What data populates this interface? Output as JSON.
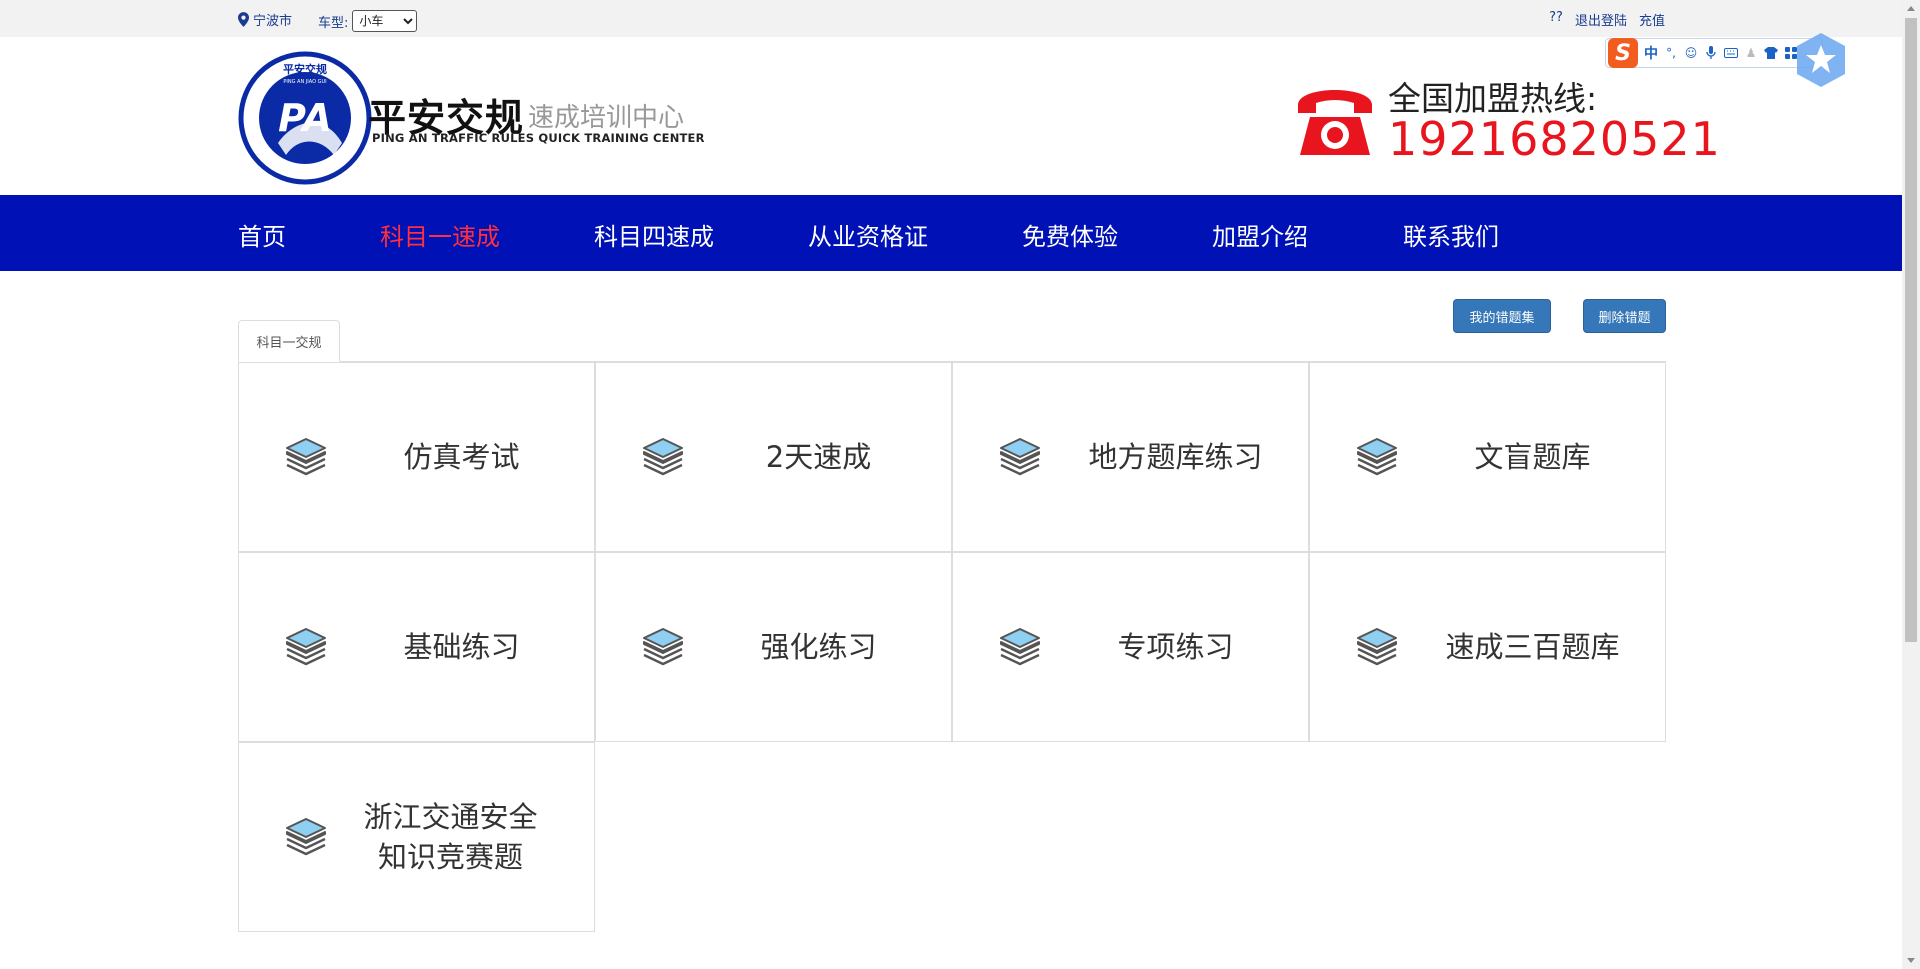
{
  "topbar": {
    "city": "宁波市",
    "car_type_label": "车型:",
    "car_type_selected": "小车",
    "links": [
      "??",
      "退出登陆",
      "充值"
    ]
  },
  "header": {
    "brand_cn": "平安交规",
    "brand_sub": "速成培训中心",
    "brand_en": "PING AN TRAFFIC RULES QUICK TRAINING CENTER",
    "logo_letters": "PA",
    "logo_ring_text": "平安交规",
    "logo_ring_en": "PING AN JIAO GUI",
    "hotline_label": "全国加盟热线:",
    "hotline_number": "19216820521"
  },
  "ime": {
    "logo": "S",
    "mode": "中",
    "icons": [
      "punctuation-icon",
      "emoji-icon",
      "microphone-icon",
      "keyboard-icon",
      "user-icon",
      "skin-icon",
      "grid-icon"
    ]
  },
  "nav": {
    "items": [
      "首页",
      "科目一速成",
      "科目四速成",
      "从业资格证",
      "免费体验",
      "加盟介绍",
      "联系我们"
    ],
    "active_index": 1
  },
  "actions": {
    "wrong_set": "我的错题集",
    "delete_wrong": "删除错题"
  },
  "tab": {
    "label": "科目一交规"
  },
  "cards": [
    "仿真考试",
    "2天速成",
    "地方题库练习",
    "文盲题库",
    "基础练习",
    "强化练习",
    "专项练习",
    "速成三百题库",
    "浙江交通安全知识竞赛题"
  ],
  "colors": {
    "nav_bg": "#0012b5",
    "nav_active": "#ff2f3c",
    "hotline_red": "#e8141e",
    "button_blue": "#3577b8",
    "logo_blue": "#0b2aa5"
  }
}
